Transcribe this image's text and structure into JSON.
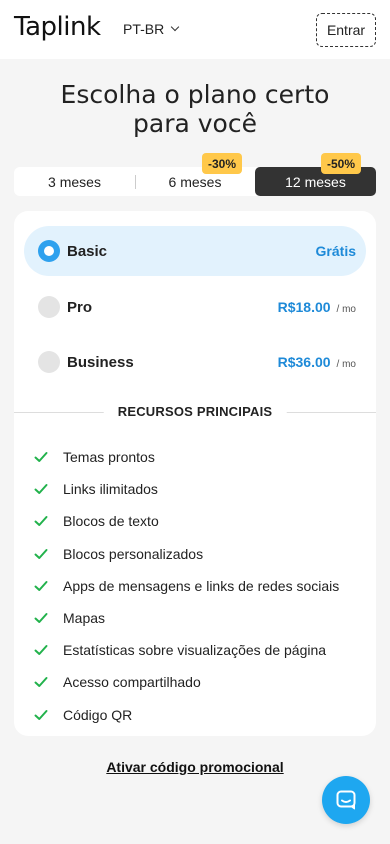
{
  "header": {
    "logo": "Taplink",
    "language": "PT-BR",
    "login_label": "Entrar"
  },
  "hero": {
    "title_line1": "Escolha o plano certo",
    "title_line2": "para você"
  },
  "periods": [
    {
      "label": "3 meses",
      "badge": "",
      "selected": false
    },
    {
      "label": "6 meses",
      "badge": "-30%",
      "selected": false
    },
    {
      "label": "12 meses",
      "badge": "-50%",
      "selected": true
    }
  ],
  "plans": [
    {
      "name": "Basic",
      "price": "Grátis",
      "unit": "",
      "selected": true
    },
    {
      "name": "Pro",
      "price": "R$18.00",
      "unit": "/ mo",
      "selected": false
    },
    {
      "name": "Business",
      "price": "R$36.00",
      "unit": "/ mo",
      "selected": false
    }
  ],
  "features_title": "RECURSOS PRINCIPAIS",
  "features": [
    "Temas prontos",
    "Links ilimitados",
    "Blocos de texto",
    "Blocos personalizados",
    "Apps de mensagens e links de redes sociais",
    "Mapas",
    "Estatísticas sobre visualizações de página",
    "Acesso compartilhado",
    "Código QR"
  ],
  "promo_link": "Ativar código promocional",
  "colors": {
    "accent": "#2ea1ee",
    "price": "#1e8ad8",
    "badge": "#ffc84a",
    "check": "#22b24c",
    "selected_period": "#333333",
    "selected_plan_bg": "#e2f2fd"
  },
  "icons": {
    "language": "chevron-down-icon",
    "features": "check-icon",
    "chat": "chat-bubble-icon"
  }
}
